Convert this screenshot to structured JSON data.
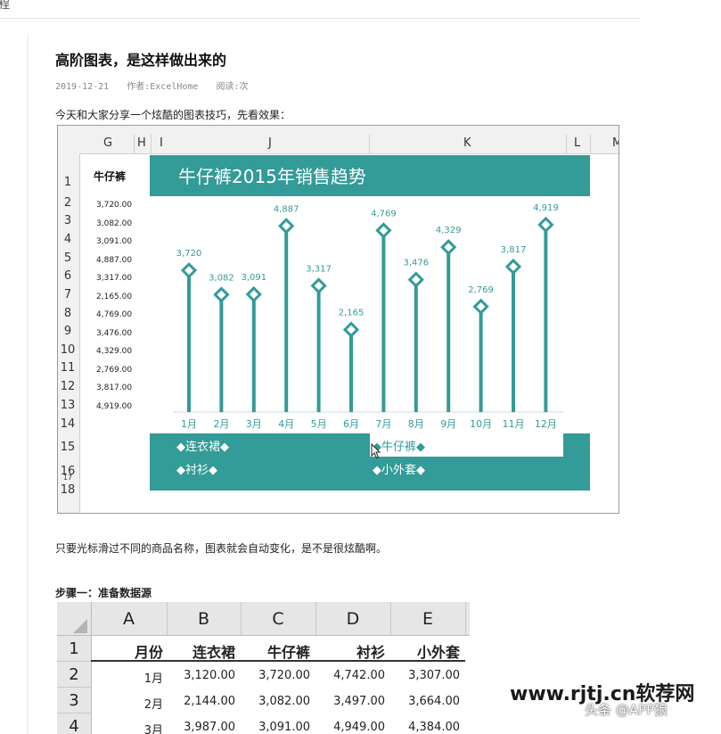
{
  "breadcrumb_fragment": "程",
  "article": {
    "title": "高阶图表，是这样做出来的",
    "date": "2019-12-21",
    "author": "作者:ExcelHome",
    "reads": "阅读:次",
    "intro": "今天和大家分享一个炫酷的图表技巧，先看效果：",
    "after_chart": "只要光标滑过不同的商品名称，图表就会自动变化，是不是很炫酷啊。",
    "step1": "步骤一：准备数据源"
  },
  "excel": {
    "columns": [
      "G",
      "H",
      "I",
      "J",
      "K",
      "L",
      "M"
    ],
    "rows": [
      "1",
      "2",
      "3",
      "4",
      "5",
      "6",
      "7",
      "8",
      "9",
      "10",
      "11",
      "12",
      "13",
      "14",
      "15",
      "16",
      "17",
      "18"
    ],
    "g_header": "牛仔裤",
    "g_values": [
      "3,720.00",
      "3,082.00",
      "3,091.00",
      "4,887.00",
      "3,317.00",
      "2,165.00",
      "4,769.00",
      "3,476.00",
      "4,329.00",
      "2,769.00",
      "3,817.00",
      "4,919.00"
    ],
    "colors": {
      "teal": "#339b98",
      "white": "#ffffff"
    },
    "selector": {
      "items": [
        "◆连衣裙◆",
        "◆牛仔裤◆",
        "◆衬衫◆",
        "◆小外套◆"
      ],
      "active": "◆牛仔裤◆"
    }
  },
  "chart_data": {
    "type": "bar",
    "title": "牛仔裤2015年销售趋势",
    "categories": [
      "1月",
      "2月",
      "3月",
      "4月",
      "5月",
      "6月",
      "7月",
      "8月",
      "9月",
      "10月",
      "11月",
      "12月"
    ],
    "values": [
      3720,
      3082,
      3091,
      4887,
      3317,
      2165,
      4769,
      3476,
      4329,
      2769,
      3817,
      4919
    ],
    "data_labels": [
      "3,720",
      "3,082",
      "3,091",
      "4,887",
      "3,317",
      "2,165",
      "4,769",
      "3,476",
      "4,329",
      "2,769",
      "3,817",
      "4,919"
    ],
    "marker": "diamond",
    "color": "#339b98",
    "ylim": [
      0,
      5200
    ],
    "grid": false
  },
  "table": {
    "columns": [
      "A",
      "B",
      "C",
      "D",
      "E"
    ],
    "row_numbers": [
      "1",
      "2",
      "3",
      "4"
    ],
    "header": [
      "月份",
      "连衣裙",
      "牛仔裤",
      "衬衫",
      "小外套"
    ],
    "rows": [
      [
        "1月",
        "3,120.00",
        "3,720.00",
        "4,742.00",
        "3,307.00"
      ],
      [
        "2月",
        "2,144.00",
        "3,082.00",
        "3,497.00",
        "3,664.00"
      ],
      [
        "3月",
        "3,987.00",
        "3,091.00",
        "4,949.00",
        "4,384.00"
      ]
    ]
  },
  "watermark": {
    "site": "www.rjtj.cn软荐网",
    "source": "头条 @APP狼"
  }
}
